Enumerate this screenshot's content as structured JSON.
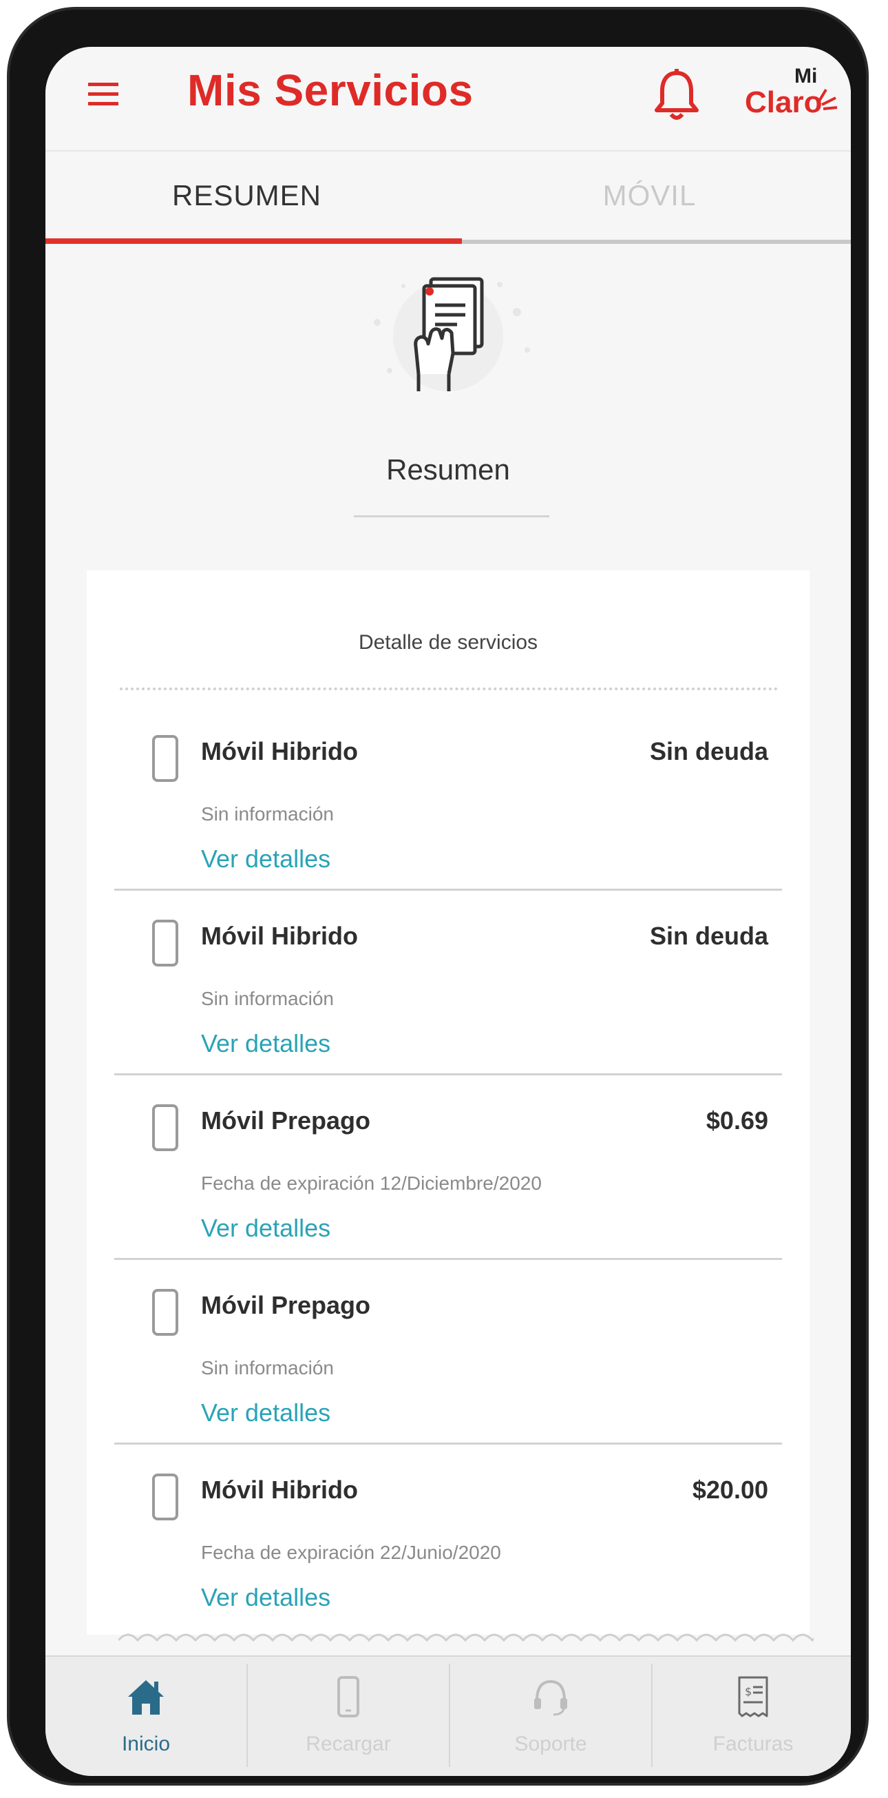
{
  "app_bar": {
    "title": "Mis Servicios",
    "brand_mi": "Mi",
    "brand_claro": "Claro",
    "accent_color": "#de2b28"
  },
  "tabs": [
    {
      "label": "RESUMEN",
      "active": true
    },
    {
      "label": "MÓVIL",
      "active": false
    }
  ],
  "summary": {
    "heading": "Resumen",
    "card_title": "Detalle de servicios"
  },
  "services": [
    {
      "name": "Móvil Hibrido",
      "amount": "Sin deuda",
      "info": "Sin información",
      "link": "Ver detalles"
    },
    {
      "name": "Móvil Hibrido",
      "amount": "Sin deuda",
      "info": "Sin información",
      "link": "Ver detalles"
    },
    {
      "name": "Móvil Prepago",
      "amount": "$0.69",
      "info": "Fecha de expiración 12/Diciembre/2020",
      "link": "Ver detalles"
    },
    {
      "name": "Móvil Prepago",
      "amount": "",
      "info": "Sin información",
      "link": "Ver detalles"
    },
    {
      "name": "Móvil Hibrido",
      "amount": "$20.00",
      "info": "Fecha de expiración 22/Junio/2020",
      "link": "Ver detalles"
    }
  ],
  "bottom_nav": [
    {
      "label": "Inicio",
      "icon": "home-icon",
      "active": true
    },
    {
      "label": "Recargar",
      "icon": "phone-icon",
      "active": false
    },
    {
      "label": "Soporte",
      "icon": "support-icon",
      "active": false
    },
    {
      "label": "Facturas",
      "icon": "invoice-icon",
      "active": false
    }
  ],
  "colors": {
    "link": "#2aa3b7",
    "nav_active": "#2b6b8a"
  }
}
